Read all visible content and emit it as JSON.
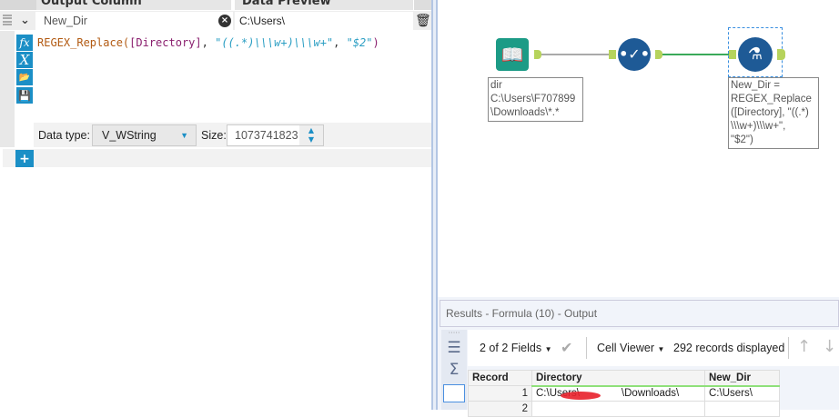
{
  "formula_panel": {
    "header_output_column": "Output Column",
    "header_data_preview": "Data Preview",
    "output_column_value": "New_Dir",
    "data_preview_value": "C:\\Users\\",
    "expression_parts": {
      "func": "REGEX_Replace(",
      "field": "[Directory]",
      "sep1": ", ",
      "pattern": "\"((.*)\\\\\\w+)\\\\\\w+\"",
      "sep2": ", ",
      "repl": "\"$2\"",
      "close": ")"
    },
    "icons": {
      "fx": "fx",
      "x": "X"
    },
    "data_type_label": "Data type:",
    "data_type_value": "V_WString",
    "size_label": "Size:",
    "size_value": "1073741823"
  },
  "canvas": {
    "input_annotation": [
      "dir",
      "C:\\Users\\F707899",
      "\\Downloads\\*.*"
    ],
    "formula_annotation": [
      "New_Dir =",
      "REGEX_Replace",
      "([Directory], \"((.*)",
      "\\\\\\w+)\\\\\\w+\",",
      "\"$2\")"
    ]
  },
  "results": {
    "title": "Results - Formula (10) - Output",
    "fields_label": "2 of 2 Fields",
    "cell_viewer_label": "Cell Viewer",
    "records_label": "292 records displayed",
    "columns": [
      "Record",
      "Directory",
      "New_Dir"
    ],
    "rows": [
      {
        "record": "1",
        "directory": "C:\\Users\\    \\Downloads\\",
        "new_dir": "C:\\Users\\"
      },
      {
        "record": "2",
        "directory": "",
        "new_dir": ""
      }
    ],
    "accent_color": "#8fe07a"
  }
}
